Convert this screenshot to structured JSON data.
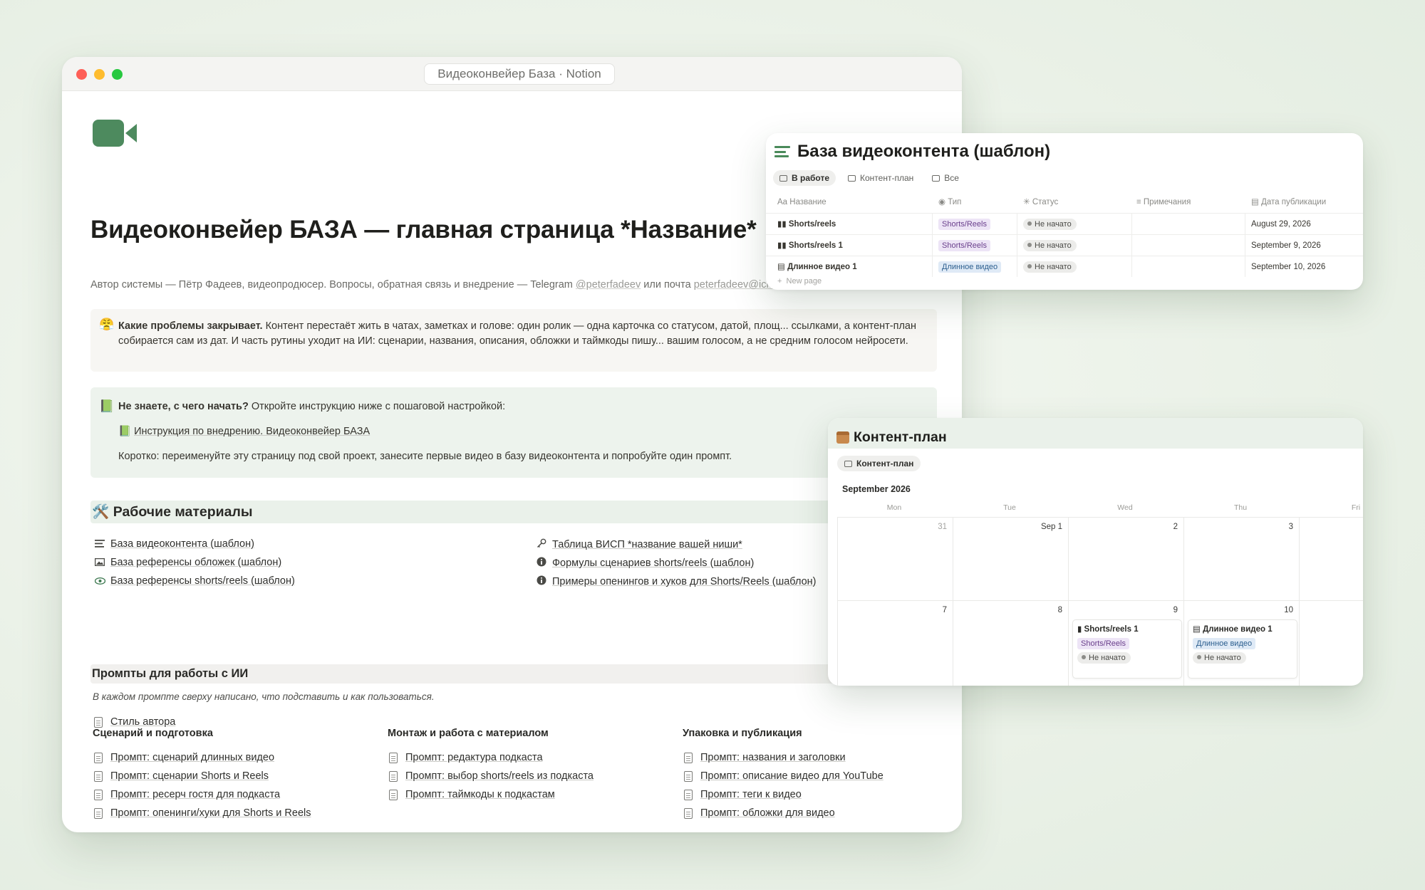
{
  "window": {
    "title": "Видеоконвейер База · Notion"
  },
  "page": {
    "title": "Видеоконвейер БАЗА — главная страница *Название*",
    "author_prefix": "Автор системы — Пётр Фадеев, видеопродюсер. Вопросы, обратная связь и внедрение — Telegram ",
    "author_telegram": "@peterfadeev",
    "author_mid": " или почта ",
    "author_email": "peterfadeev@icloud",
    "callout_problems": {
      "emoji": "😤",
      "bold": "Какие проблемы закрывает.",
      "text": " Контент перестаёт жить в чатах, заметках и голове: один ролик — одна карточка со статусом, датой, площ... ссылками, а контент-план собирается сам из дат. И часть рутины уходит на ИИ: сценарии, названия, описания, обложки и таймкоды пишу... вашим голосом, а не средним голосом нейросети."
    },
    "callout_start": {
      "emoji": "📗",
      "bold": "Не знаете, с чего начать?",
      "text": " Откройте инструкцию ниже с пошаговой настройкой:",
      "link_emoji": "📗",
      "link": "Инструкция по внедрению. Видеоконвейер БАЗА",
      "note": "Коротко: переименуйте эту страницу под свой проект, занесите первые видео в базу видеоконтента и попробуйте один промпт."
    },
    "materials": {
      "heading": "🛠️ Рабочие материалы",
      "left": [
        {
          "icon": "lines-icon",
          "label": "База видеоконтента (шаблон)"
        },
        {
          "icon": "image-icon",
          "label": "База референсы обложек (шаблон)"
        },
        {
          "icon": "eye-icon",
          "label": "База референсы shorts/reels (шаблон)"
        }
      ],
      "right": [
        {
          "icon": "key-icon",
          "label": "Таблица ВИСП *название вашей ниши*"
        },
        {
          "icon": "info-icon",
          "label": "Формулы сценариев shorts/reels (шаблон)"
        },
        {
          "icon": "info-icon",
          "label": "Примеры опенингов и хуков для Shorts/Reels (шаблон)"
        }
      ]
    },
    "prompts": {
      "heading": "Промпты для работы с ИИ",
      "hint": "В каждом промпте сверху написано, что подставить и как пользоваться.",
      "style": "Стиль автора",
      "columns": [
        {
          "title": "Сценарий и подготовка",
          "items": [
            "Промпт: сценарий длинных видео",
            "Промпт: сценарии Shorts и Reels",
            "Промпт: ресерч гостя для подкаста",
            "Промпт: опенинги/хуки для Shorts и Reels"
          ]
        },
        {
          "title": "Монтаж и работа с материалом",
          "items": [
            "Промпт: редактура подкаста",
            "Промпт: выбор shorts/reels из подкаста",
            "Промпт: таймкоды к подкастам"
          ]
        },
        {
          "title": "Упаковка и публикация",
          "items": [
            "Промпт: названия и заголовки",
            "Промпт: описание видео для YouTube",
            "Промпт: теги к видео",
            "Промпт: обложки для видео"
          ]
        }
      ]
    }
  },
  "database": {
    "title": "База видеоконтента (шаблон)",
    "tabs": [
      "В работе",
      "Контент-план",
      "Все"
    ],
    "columns": [
      "Название",
      "Тип",
      "Статус",
      "Примечания",
      "Дата публикации"
    ],
    "column_prefix": {
      "name": "Aa"
    },
    "rows": [
      {
        "name": "Shorts/reels",
        "type": "Shorts/Reels",
        "status": "Не начато",
        "notes": "",
        "date": "August 29, 2026"
      },
      {
        "name": "Shorts/reels 1",
        "type": "Shorts/Reels",
        "status": "Не начато",
        "notes": "",
        "date": "September 9, 2026"
      },
      {
        "name": "Длинное видео 1",
        "type": "Длинное видео",
        "status": "Не начато",
        "notes": "",
        "date": "September 10, 2026"
      }
    ],
    "new_page": "New page"
  },
  "calendar": {
    "title": "Контент-план",
    "tab": "Контент-план",
    "month": "September 2026",
    "weekdays": [
      "Mon",
      "Tue",
      "Wed",
      "Thu",
      "Fri"
    ],
    "week1": [
      "31",
      "Sep 1",
      "2",
      "3"
    ],
    "week2": [
      "7",
      "8",
      "9",
      "10"
    ],
    "events": [
      {
        "day": "9",
        "title": "Shorts/reels 1",
        "type": "Shorts/Reels",
        "status": "Не начато"
      },
      {
        "day": "10",
        "title": "Длинное видео 1",
        "type": "Длинное видео",
        "status": "Не начато"
      }
    ]
  },
  "colors": {
    "accent_green": "#4a8a5a",
    "callout_green": "#edf3ed",
    "tag_purple": "#ede4f6",
    "tag_blue": "#dfeaf6"
  }
}
